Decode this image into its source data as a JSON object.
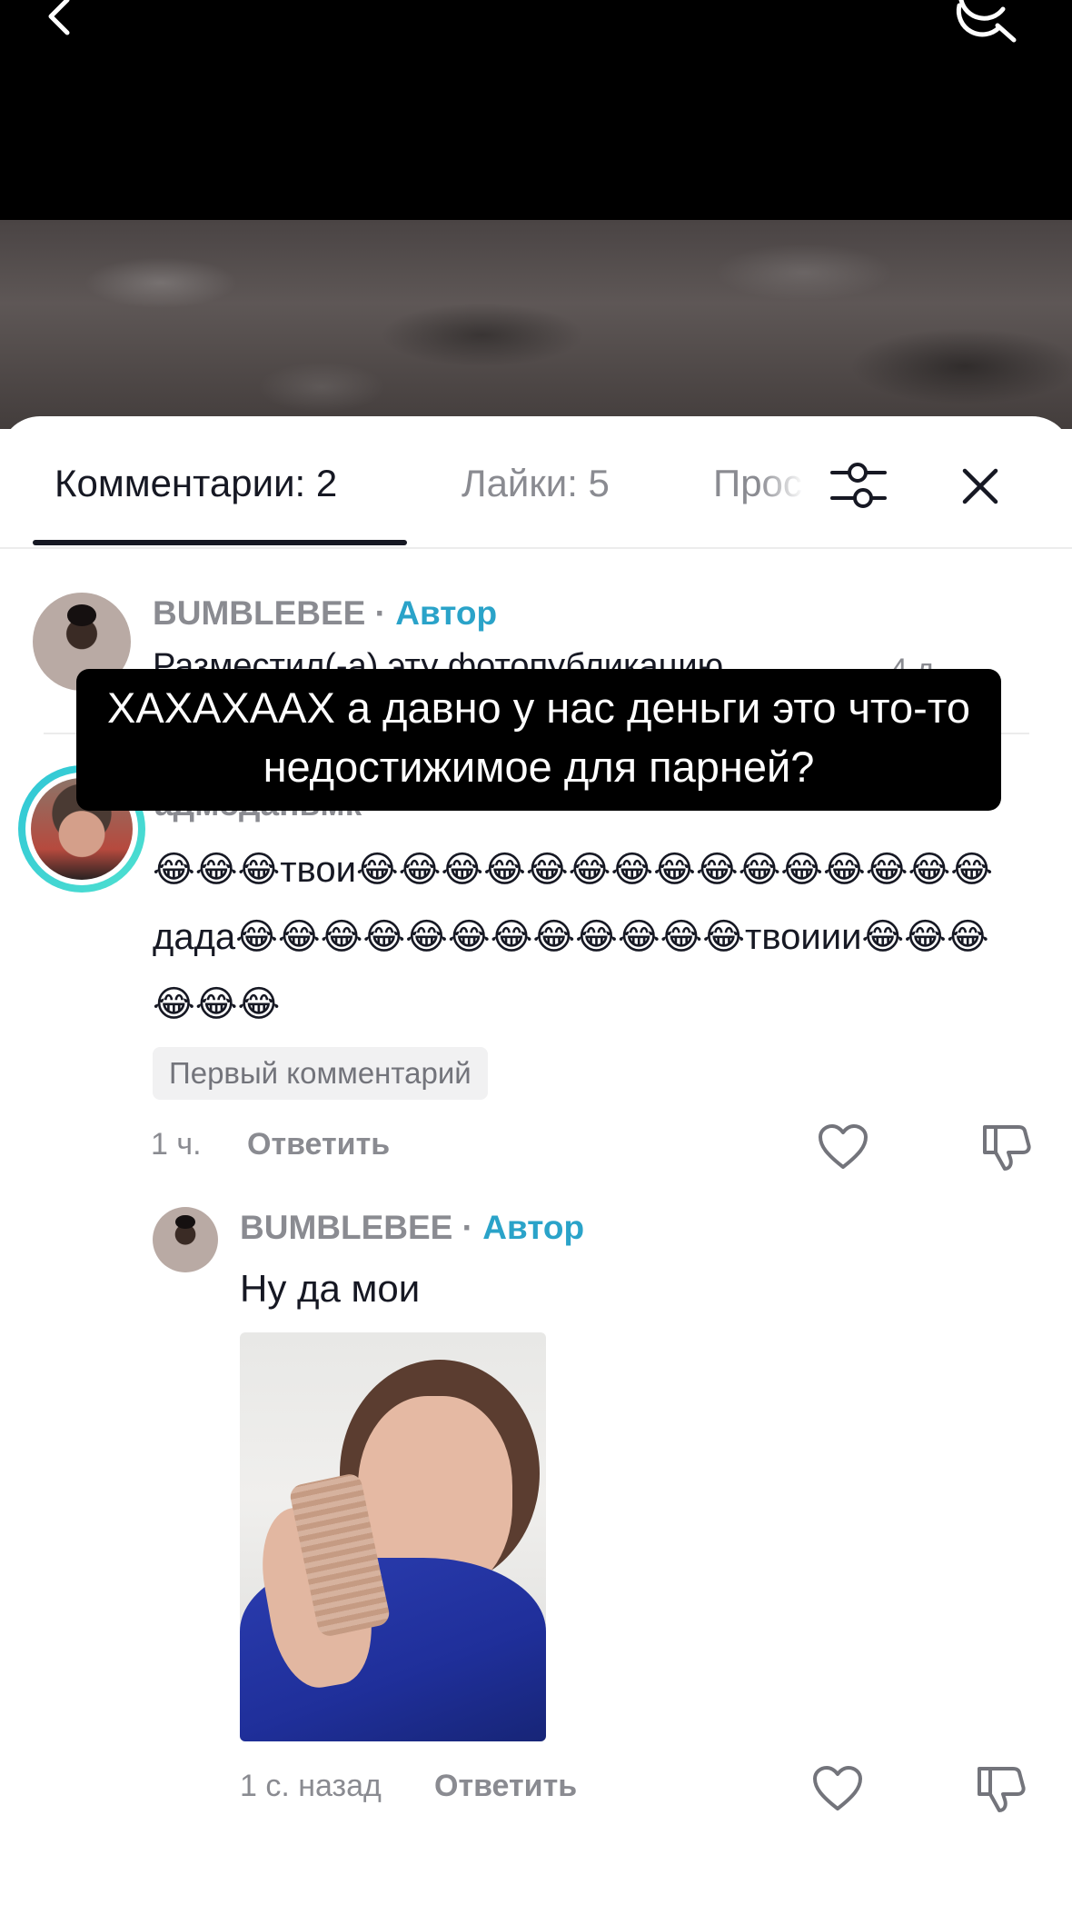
{
  "header": {
    "back_icon": "chevron-left-icon",
    "search_icon": "search-icon"
  },
  "tabs": {
    "comments": "Комментарии: 2",
    "likes": "Лайки: 5",
    "views": "Просмотры",
    "filter_icon": "sliders-icon",
    "close_icon": "close-icon"
  },
  "caption": {
    "author_name": "BUMBLEBEE",
    "separator": " · ",
    "author_badge": "Автор",
    "text": "Разместил(-а) эту фотопубликацию",
    "date": "4 д."
  },
  "comments": [
    {
      "username": "адмоданьмк",
      "text": "😂😂😂твои😂😂😂😂😂😂😂😂😂😂😂😂😂😂😂дада😂😂😂😂😂😂😂😂😂😂😂😂твоиии😂😂😂😂😂😂",
      "badge": "Первый комментарий",
      "time": "1 ч.",
      "reply_label": "Ответить",
      "replies": [
        {
          "username": "BUMBLEBEE",
          "separator": " · ",
          "author_badge": "Автор",
          "text": "Ну да мои",
          "time": "1 с. назад",
          "reply_label": "Ответить"
        }
      ]
    }
  ],
  "tooltip": {
    "text": "ХАХАХААХ а давно у нас деньги это что-то недостижимое для парней?"
  },
  "colors": {
    "accent": "#2aa3c9",
    "ring": "#2fc6d6",
    "text": "#161823",
    "muted": "#8a8b91"
  }
}
